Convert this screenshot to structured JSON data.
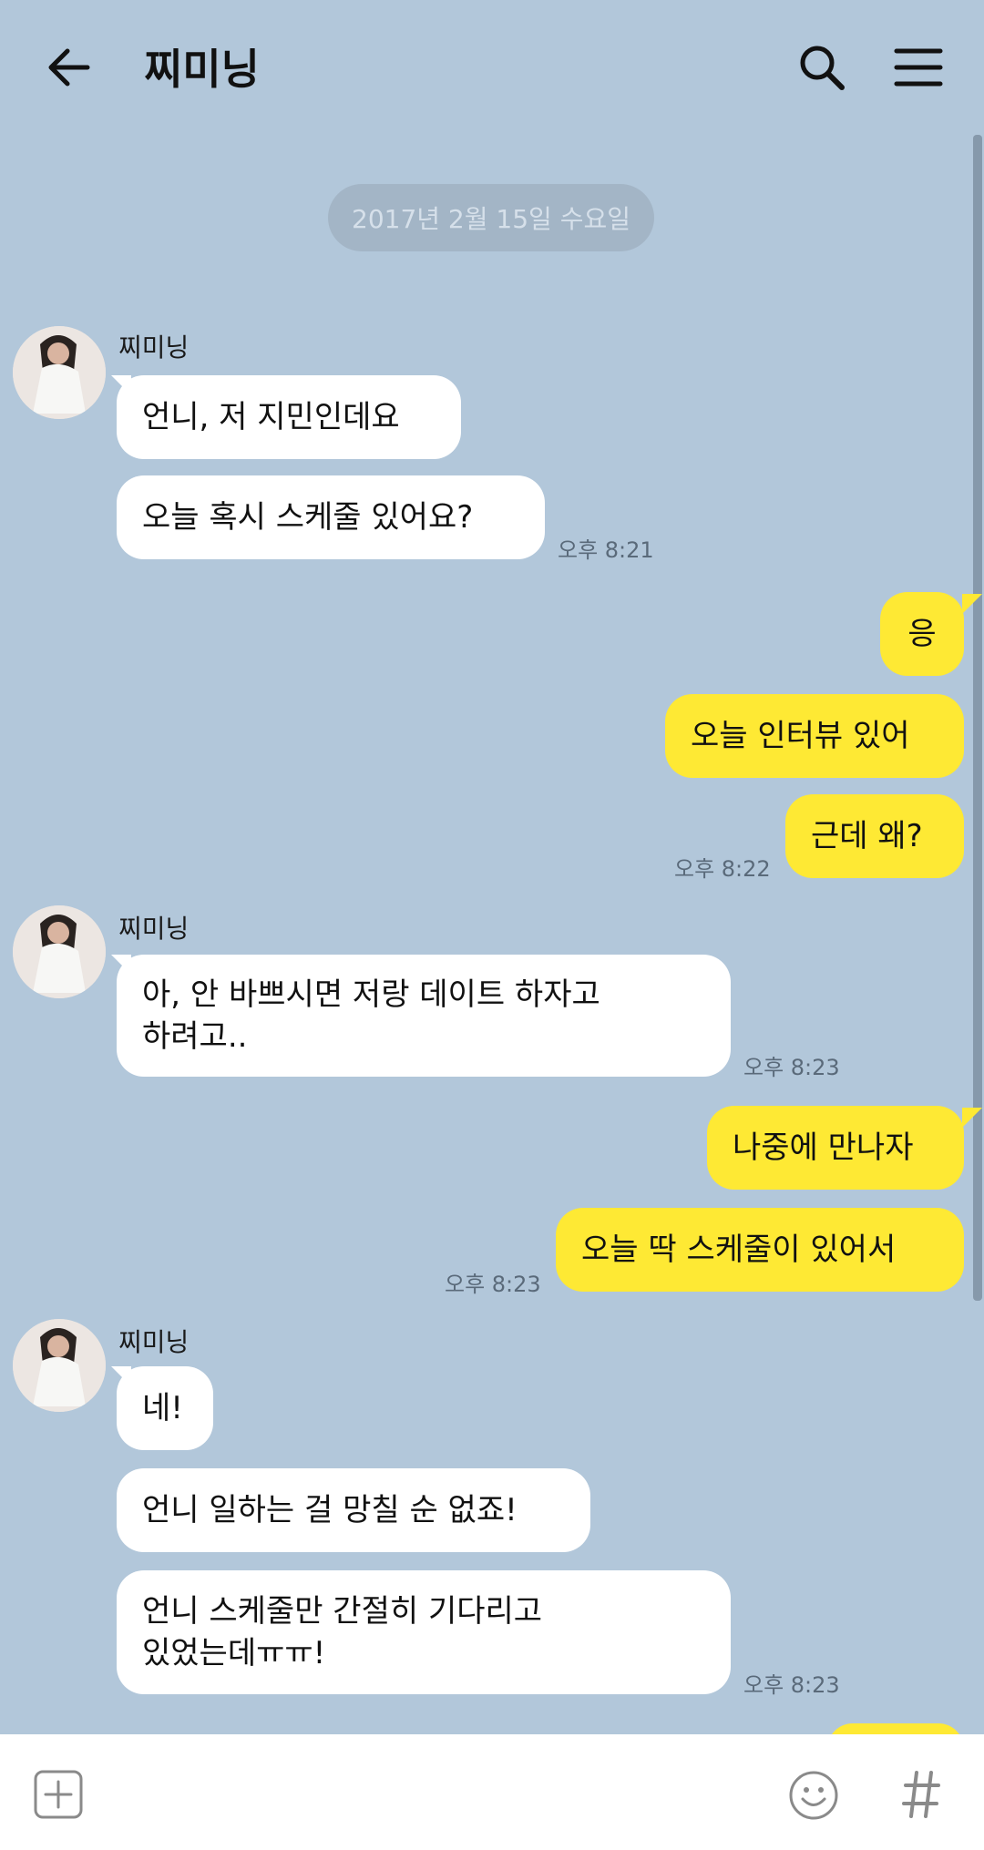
{
  "header": {
    "title": "찌미닝",
    "back_icon": "arrow-left-icon",
    "search_icon": "search-icon",
    "menu_icon": "hamburger-menu-icon"
  },
  "date_separator": "2017년 2월 15일 수요일",
  "colors": {
    "background": "#b2c7da",
    "incoming_bubble": "#ffffff",
    "outgoing_bubble": "#fee934"
  },
  "messages": {
    "g1": {
      "sender": "찌미닝",
      "m1": "언니, 저 지민인데요",
      "m2": "오늘 혹시 스케줄 있어요?",
      "time": "오후 8:21"
    },
    "g2": {
      "m1": "응",
      "m2": "오늘 인터뷰 있어",
      "m3": "근데 왜?",
      "time": "오후 8:22"
    },
    "g3": {
      "sender": "찌미닝",
      "line1": "아, 안 바쁘시면 저랑 데이트 하자고",
      "line2": "하려고..",
      "time": "오후 8:23"
    },
    "g4": {
      "m1": "나중에 만나자",
      "m2": "오늘 딱 스케줄이 있어서",
      "time": "오후 8:23"
    },
    "g5": {
      "sender": "찌미닝",
      "m1": "네!",
      "m2": "언니 일하는 걸 망칠 순 없죠!",
      "line1": "언니 스케줄만 간절히 기다리고",
      "line2": "있었는데ㅠㅠ!",
      "time": "오후 8:23"
    }
  },
  "input_bar": {
    "plus_icon": "plus-square-icon",
    "emoji_icon": "emoji-icon",
    "hash_icon": "hash-icon"
  }
}
